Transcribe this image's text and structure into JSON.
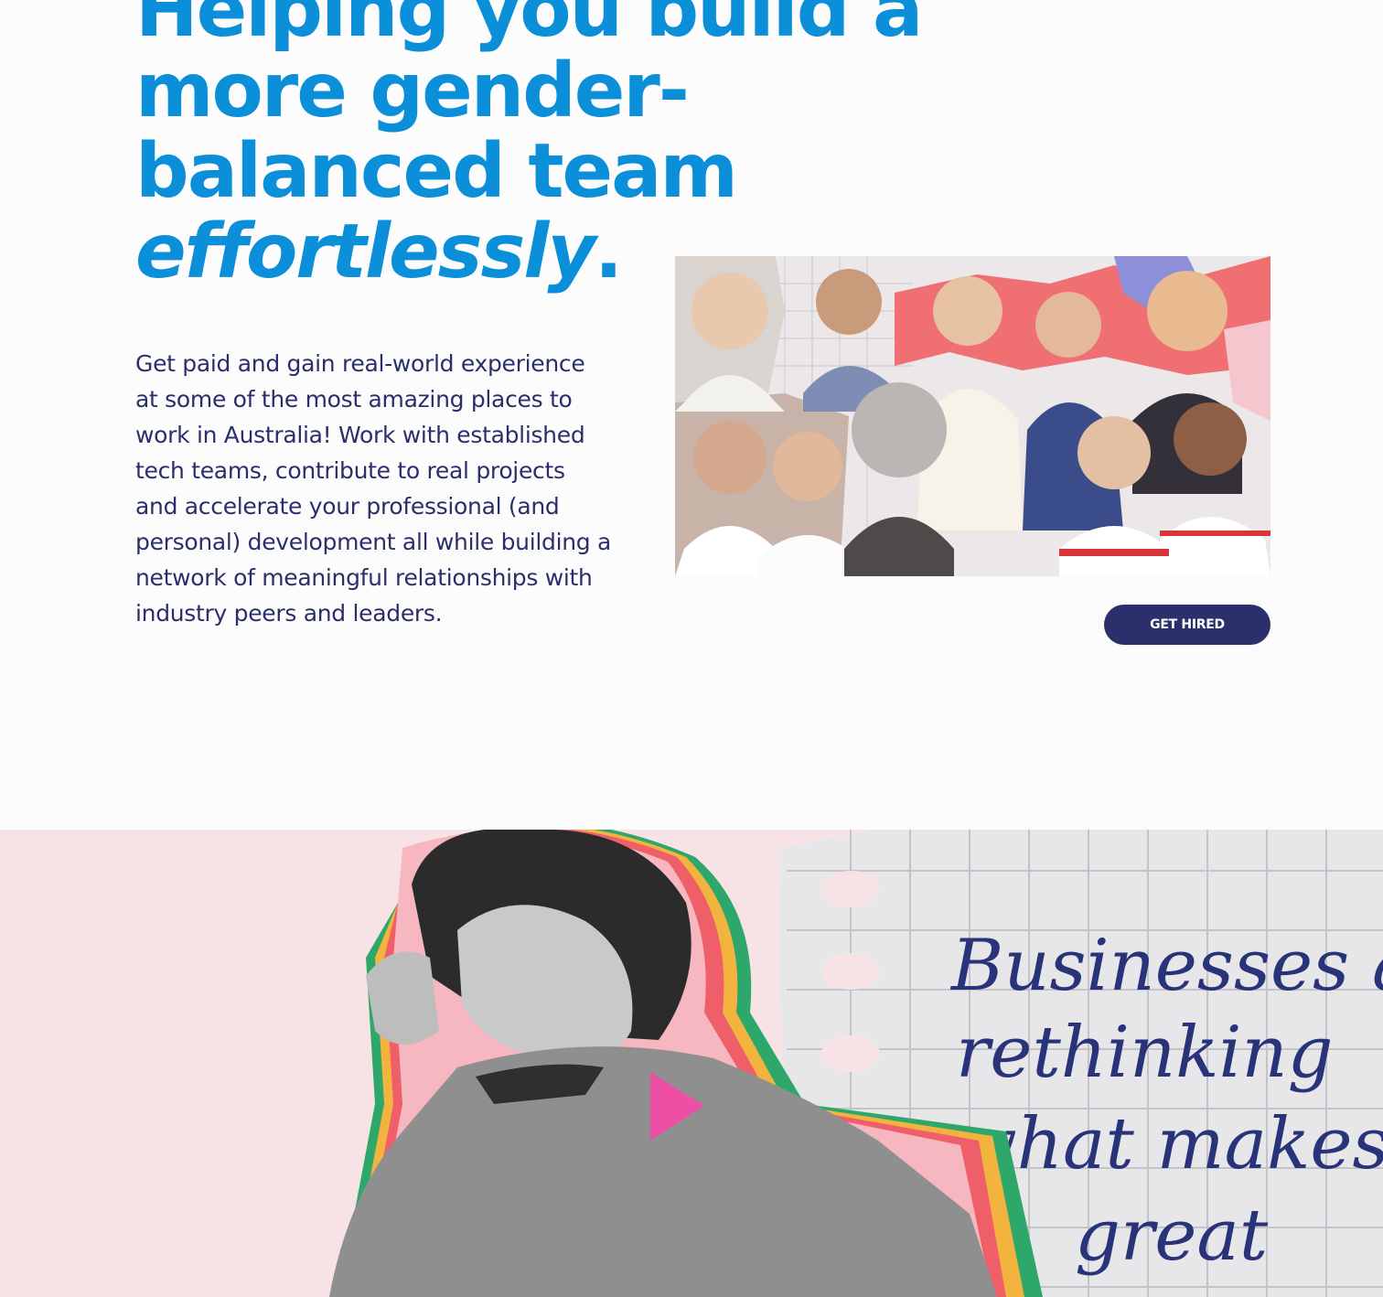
{
  "hero": {
    "heading_line1": "Helping you build a",
    "heading_line2": "more gender-",
    "heading_line3": "balanced team",
    "heading_emphasis": "effortlessly",
    "heading_period": ".",
    "body": "Get paid and gain real-world experience at some of the most amazing places to work in Australia! Work with established tech teams, contribute to real projects and accelerate your professional (and personal) development all while building a network of meaningful relationships with industry peers and leaders.",
    "cta_label": "GET HIRED"
  },
  "video": {
    "note_line1": "Businesses are",
    "note_line2": "rethinking",
    "note_line3": "what makes",
    "note_line4": "great",
    "play_icon": "play-icon"
  },
  "colors": {
    "heading": "#0b8fd9",
    "body_text": "#2a2f6b",
    "cta_bg": "#2b2f6b",
    "video_bg": "#f7e3e5",
    "play": "#ec4fa3"
  }
}
